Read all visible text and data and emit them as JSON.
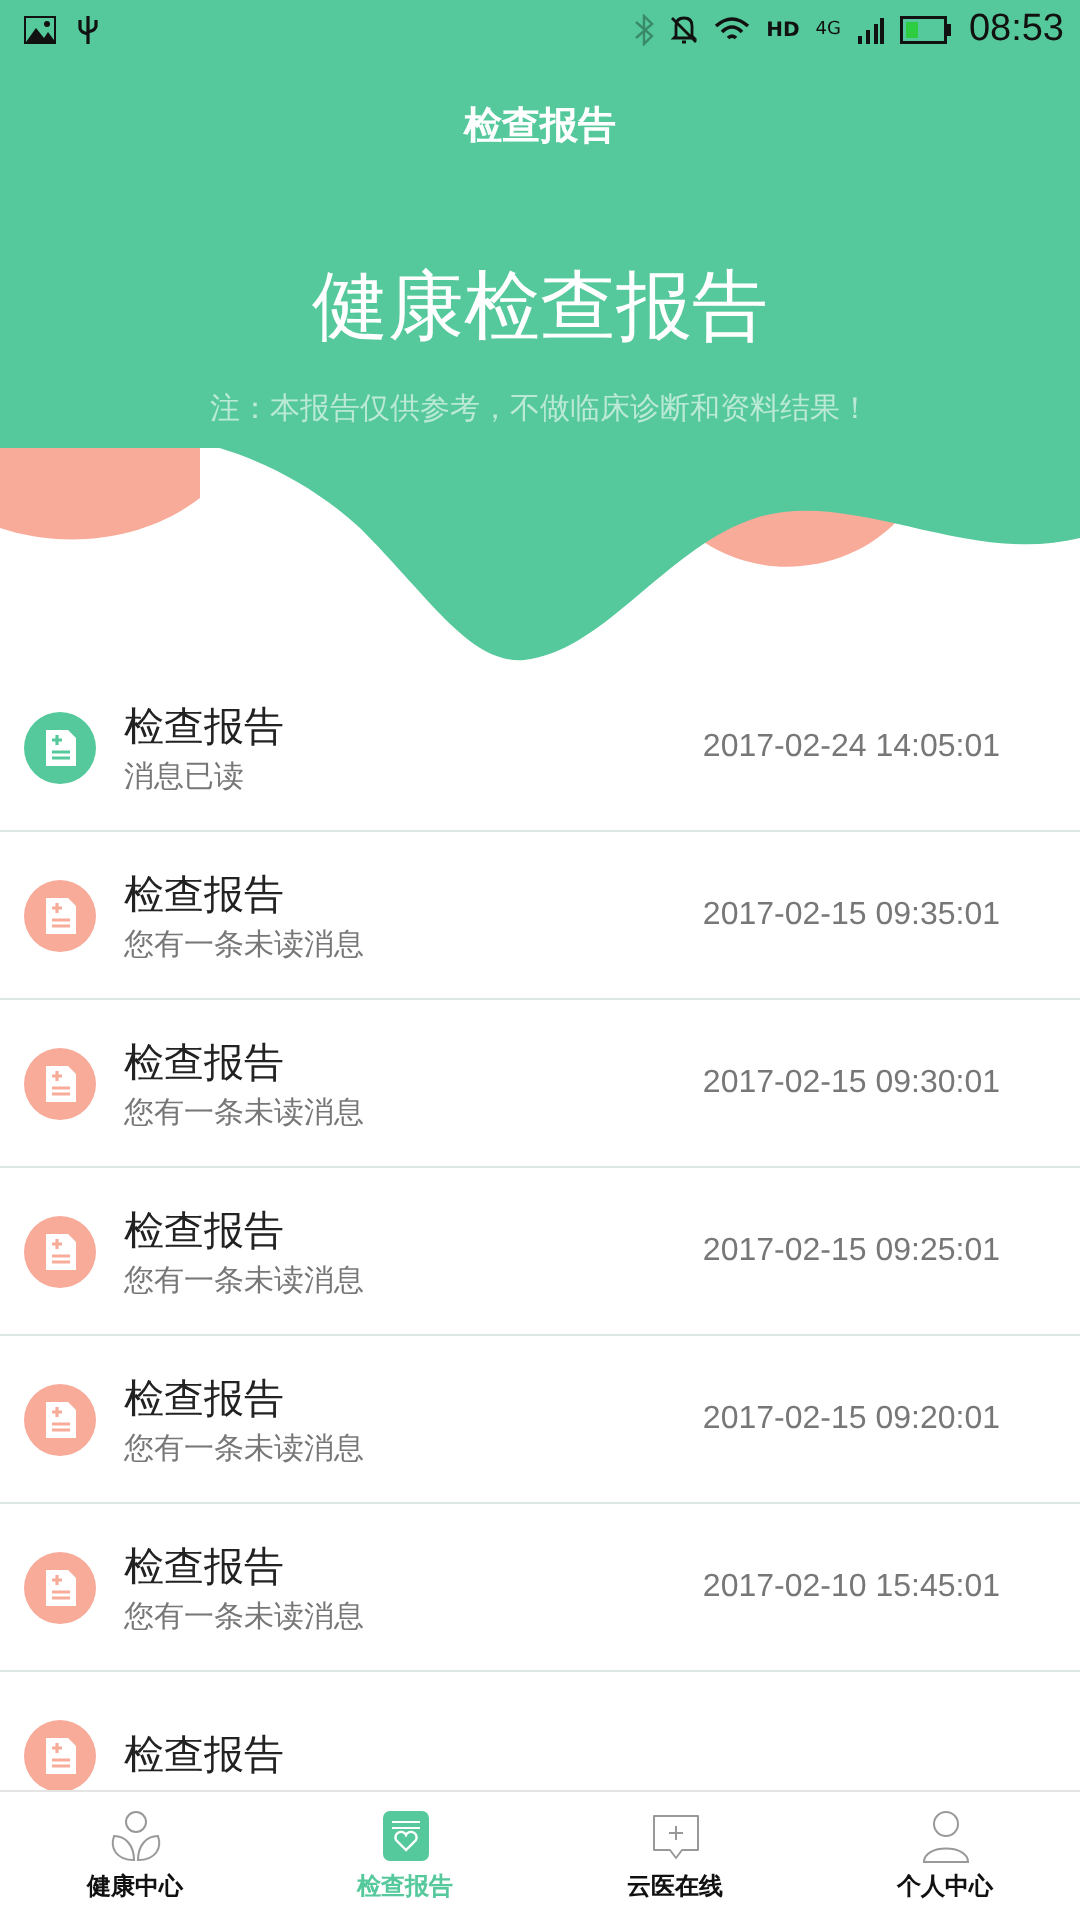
{
  "status_bar": {
    "hd": "HD",
    "network": "4G",
    "time": "08:53"
  },
  "header": {
    "title": "检查报告",
    "heading": "健康检查报告",
    "note": "注：本报告仅供参考，不做临床诊断和资料结果！"
  },
  "reports": [
    {
      "title": "检查报告",
      "subtitle": "消息已读",
      "time": "2017-02-24 14:05:01",
      "read": true
    },
    {
      "title": "检查报告",
      "subtitle": "您有一条未读消息",
      "time": "2017-02-15 09:35:01",
      "read": false
    },
    {
      "title": "检查报告",
      "subtitle": "您有一条未读消息",
      "time": "2017-02-15 09:30:01",
      "read": false
    },
    {
      "title": "检查报告",
      "subtitle": "您有一条未读消息",
      "time": "2017-02-15 09:25:01",
      "read": false
    },
    {
      "title": "检查报告",
      "subtitle": "您有一条未读消息",
      "time": "2017-02-15 09:20:01",
      "read": false
    },
    {
      "title": "检查报告",
      "subtitle": "您有一条未读消息",
      "time": "2017-02-10 15:45:01",
      "read": false
    },
    {
      "title": "检查报告",
      "read": false
    }
  ],
  "nav": [
    {
      "kind": "health",
      "label": "健康中心",
      "selected": false
    },
    {
      "kind": "report",
      "label": "检查报告",
      "selected": true
    },
    {
      "kind": "consult",
      "label": "云医在线",
      "selected": false
    },
    {
      "kind": "profile",
      "label": "个人中心",
      "selected": false
    }
  ]
}
